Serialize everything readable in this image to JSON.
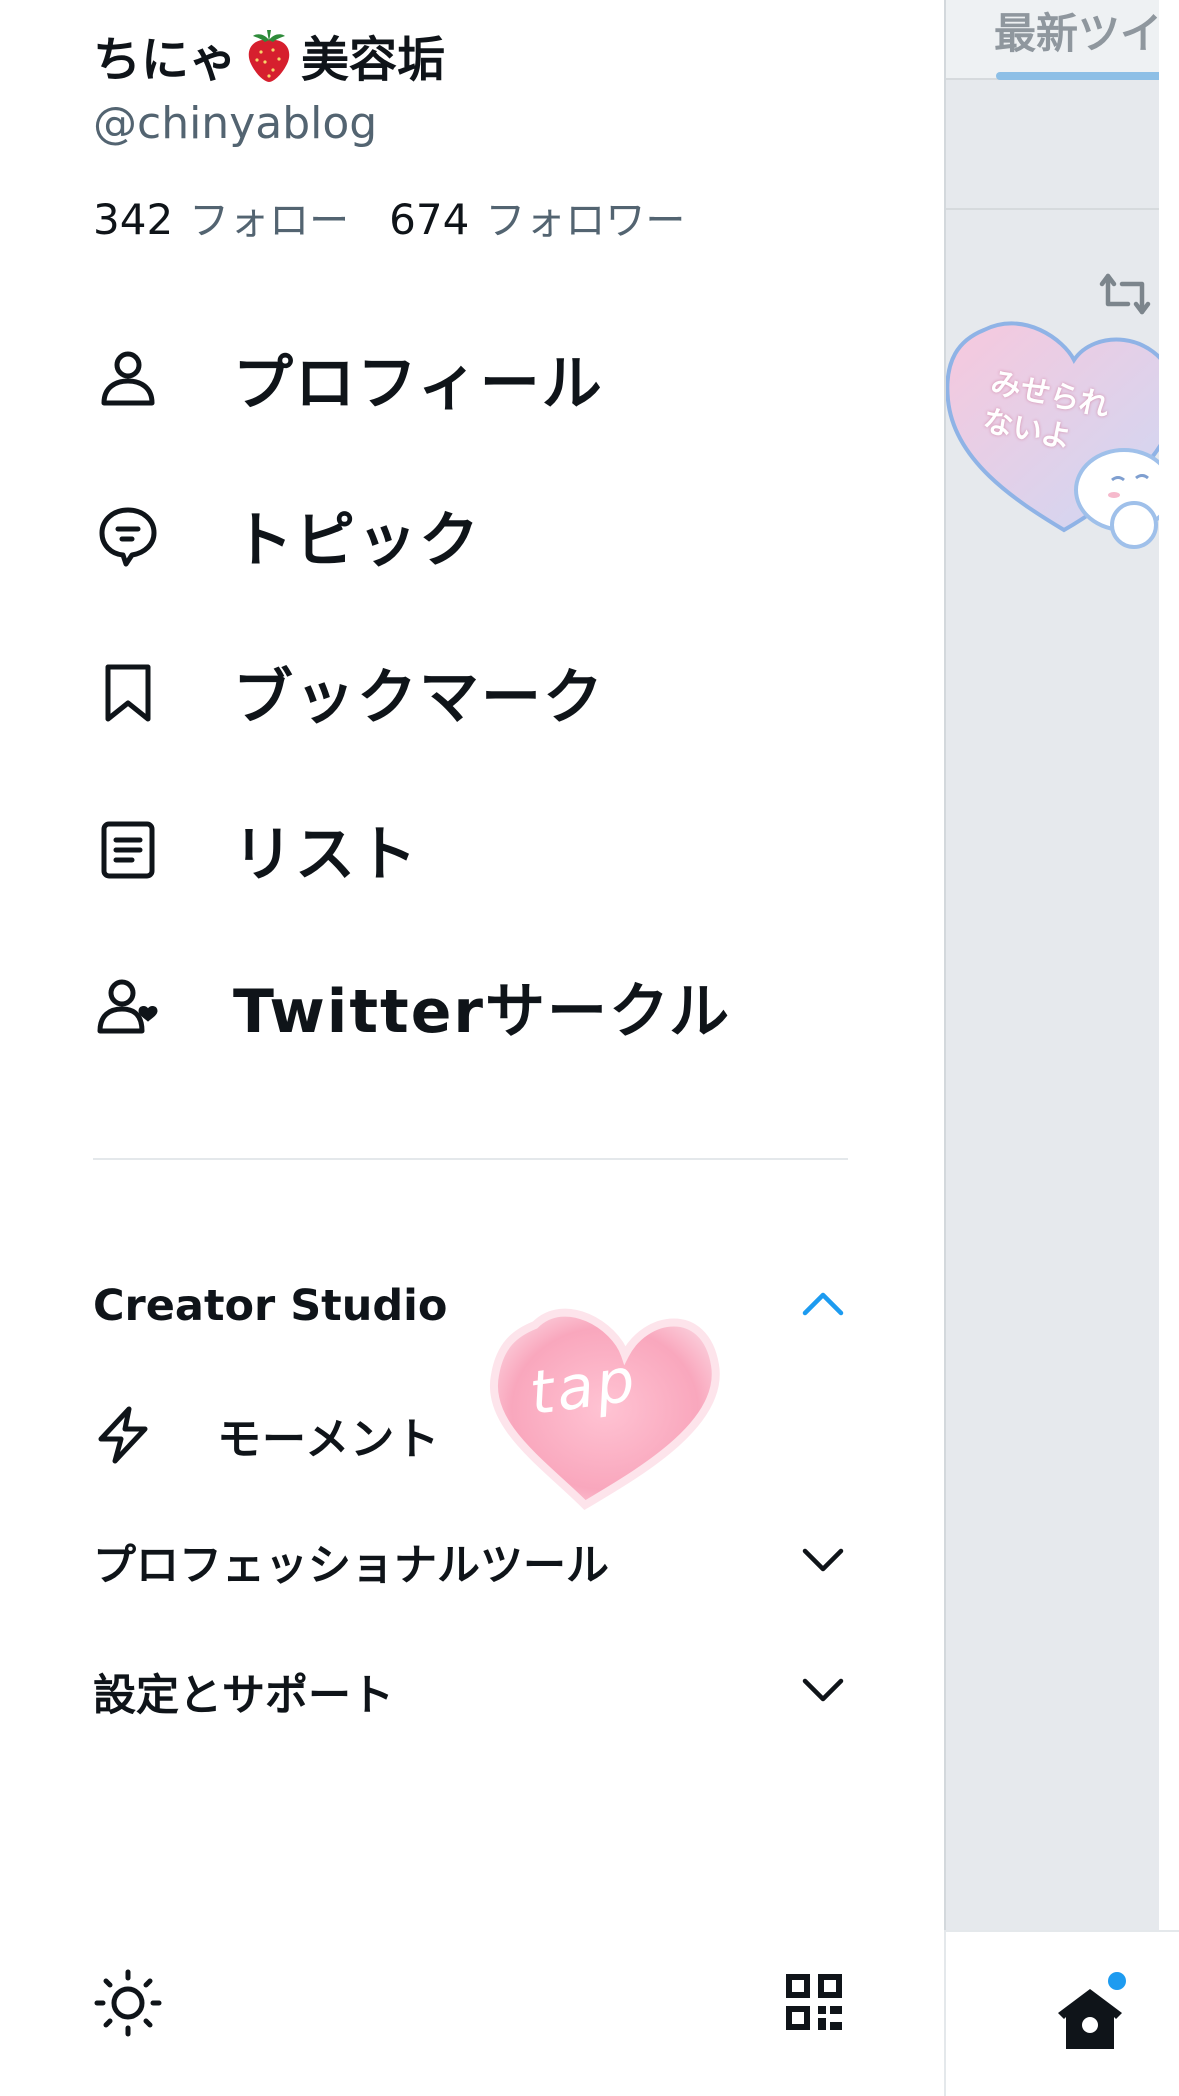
{
  "account": {
    "name_before": "ちにゃ",
    "name_after": "美容垢",
    "handle": "@chinyablog",
    "following_count": "342",
    "following_label": "フォロー",
    "followers_count": "674",
    "followers_label": "フォロワー"
  },
  "menu": {
    "items": [
      {
        "label": "プロフィール",
        "icon": "person-icon"
      },
      {
        "label": "トピック",
        "icon": "topic-bubble-icon"
      },
      {
        "label": "ブックマーク",
        "icon": "bookmark-icon"
      },
      {
        "label": "リスト",
        "icon": "list-document-icon"
      },
      {
        "label": "Twitterサークル",
        "icon": "person-heart-icon"
      }
    ]
  },
  "sections": {
    "creator_studio": {
      "label": "Creator Studio",
      "state": "expanded"
    },
    "moments": {
      "label": "モーメント",
      "icon": "lightning-icon"
    },
    "professional_tools": {
      "label": "プロフェッショナルツール",
      "state": "collapsed"
    },
    "settings_support": {
      "label": "設定とサポート",
      "state": "collapsed"
    }
  },
  "overlay": {
    "tap_sticker_text": "tap"
  },
  "background_timeline": {
    "tab_label": "最新ツイ",
    "sticker_line1": "みせられ",
    "sticker_line2": "ないよ"
  },
  "footer": {
    "left_icon": "brightness-icon",
    "right_icon": "qr-code-icon"
  },
  "tabbar": {
    "icon": "home-icon",
    "has_notification_dot": true
  },
  "colors": {
    "accent": "#1d9bf0",
    "text_primary": "#0f1419",
    "text_secondary": "#536471",
    "divider": "#e4e8eb",
    "dim_background": "#e6e9ed",
    "tap_heart": "#f9b3c6"
  }
}
